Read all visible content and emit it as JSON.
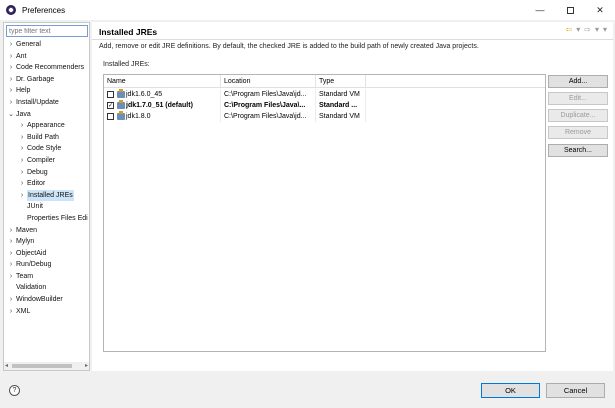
{
  "window": {
    "title": "Preferences",
    "minimize": "—",
    "close": "✕"
  },
  "filter": {
    "placeholder": "type filter text"
  },
  "tree": [
    {
      "label": "General",
      "arrow": "›",
      "level": 0
    },
    {
      "label": "Ant",
      "arrow": "›",
      "level": 0
    },
    {
      "label": "Code Recommenders",
      "arrow": "›",
      "level": 0
    },
    {
      "label": "Dr. Garbage",
      "arrow": "›",
      "level": 0
    },
    {
      "label": "Help",
      "arrow": "›",
      "level": 0
    },
    {
      "label": "Install/Update",
      "arrow": "›",
      "level": 0
    },
    {
      "label": "Java",
      "arrow": "⌄",
      "level": 0
    },
    {
      "label": "Appearance",
      "arrow": "›",
      "level": 1
    },
    {
      "label": "Build Path",
      "arrow": "›",
      "level": 1
    },
    {
      "label": "Code Style",
      "arrow": "›",
      "level": 1
    },
    {
      "label": "Compiler",
      "arrow": "›",
      "level": 1
    },
    {
      "label": "Debug",
      "arrow": "›",
      "level": 1
    },
    {
      "label": "Editor",
      "arrow": "›",
      "level": 1
    },
    {
      "label": "Installed JREs",
      "arrow": "›",
      "level": 1,
      "selected": true
    },
    {
      "label": "JUnit",
      "arrow": "",
      "level": 1
    },
    {
      "label": "Properties Files Edi",
      "arrow": "",
      "level": 1
    },
    {
      "label": "Maven",
      "arrow": "›",
      "level": 0
    },
    {
      "label": "Mylyn",
      "arrow": "›",
      "level": 0
    },
    {
      "label": "ObjectAid",
      "arrow": "›",
      "level": 0
    },
    {
      "label": "Run/Debug",
      "arrow": "›",
      "level": 0
    },
    {
      "label": "Team",
      "arrow": "›",
      "level": 0
    },
    {
      "label": "Validation",
      "arrow": "",
      "level": 0
    },
    {
      "label": "WindowBuilder",
      "arrow": "›",
      "level": 0
    },
    {
      "label": "XML",
      "arrow": "›",
      "level": 0
    }
  ],
  "page": {
    "title": "Installed JREs",
    "description": "Add, remove or edit JRE definitions. By default, the checked JRE is added to the build path of newly created Java projects.",
    "section_label": "Installed JREs:",
    "nav": [
      "⇦",
      "▾",
      "⇨",
      "▾",
      "▾"
    ]
  },
  "table": {
    "columns": [
      "Name",
      "Location",
      "Type"
    ],
    "rows": [
      {
        "name": "jdk1.6.0_45",
        "location": "C:\\Program Files\\Java\\jd...",
        "type": "Standard VM",
        "checked": false,
        "bold": false
      },
      {
        "name": "jdk1.7.0_51 (default)",
        "location": "C:\\Program Files\\Java\\...",
        "type": "Standard ...",
        "checked": true,
        "bold": true
      },
      {
        "name": "jdk1.8.0",
        "location": "C:\\Program Files\\Java\\jd...",
        "type": "Standard VM",
        "checked": false,
        "bold": false
      }
    ]
  },
  "buttons": [
    {
      "label": "Add...",
      "enabled": true
    },
    {
      "label": "Edit...",
      "enabled": false
    },
    {
      "label": "Duplicate...",
      "enabled": false
    },
    {
      "label": "Remove",
      "enabled": false
    },
    {
      "label": "Search...",
      "enabled": true
    }
  ],
  "footer": {
    "help": "?",
    "ok": "OK",
    "cancel": "Cancel"
  },
  "colors": {
    "selection": "#cce4f7",
    "ok_border": "#0078d7"
  }
}
